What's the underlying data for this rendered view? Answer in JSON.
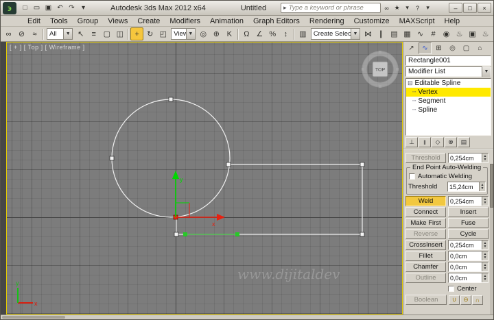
{
  "window": {
    "app_title": "Autodesk 3ds Max  2012 x64",
    "doc_title": "Untitled",
    "search_go_glyph": "▸",
    "search_placeholder": "Type a keyword or phrase",
    "quick_access": [
      {
        "name": "new-scene-button",
        "glyph": "□"
      },
      {
        "name": "open-file-button",
        "glyph": "▭"
      },
      {
        "name": "save-file-button",
        "glyph": "▣"
      },
      {
        "name": "undo-button",
        "glyph": "↶"
      },
      {
        "name": "redo-button",
        "glyph": "↷"
      },
      {
        "name": "workspace-dropdown-button",
        "glyph": "▾"
      }
    ],
    "search_icons": [
      {
        "name": "search-binoculars-icon",
        "glyph": "∞"
      },
      {
        "name": "favorites-star-icon",
        "glyph": "★"
      },
      {
        "name": "search-options-chevron-icon",
        "glyph": "▾"
      },
      {
        "name": "help-icon",
        "glyph": "?"
      },
      {
        "name": "help-chevron-icon",
        "glyph": "▾"
      }
    ],
    "controls": [
      {
        "name": "minimize-button",
        "glyph": "–"
      },
      {
        "name": "maximize-button",
        "glyph": "□"
      },
      {
        "name": "close-button",
        "glyph": "×"
      }
    ]
  },
  "menu": {
    "items": [
      "Edit",
      "Tools",
      "Group",
      "Views",
      "Create",
      "Modifiers",
      "Animation",
      "Graph Editors",
      "Rendering",
      "Customize",
      "MAXScript",
      "Help"
    ]
  },
  "toolbar": {
    "link_icons": [
      {
        "name": "select-and-link-icon",
        "glyph": "∞"
      },
      {
        "name": "unlink-selection-icon",
        "glyph": "⊘"
      },
      {
        "name": "bind-to-space-warp-icon",
        "glyph": "≈"
      }
    ],
    "filter_label": "All",
    "select_icons": [
      {
        "name": "select-object-icon",
        "glyph": "↖"
      },
      {
        "name": "select-by-name-icon",
        "glyph": "≡"
      },
      {
        "name": "rectangular-selection-region-icon",
        "glyph": "▢"
      },
      {
        "name": "window-crossing-icon",
        "glyph": "◫"
      }
    ],
    "transform_icons": [
      {
        "name": "select-and-move-icon",
        "glyph": "+",
        "active": true
      },
      {
        "name": "select-and-rotate-icon",
        "glyph": "↻"
      },
      {
        "name": "select-and-scale-icon",
        "glyph": "◰"
      }
    ],
    "coord_label": "View",
    "pivot_icons": [
      {
        "name": "use-pivot-point-center-icon",
        "glyph": "◎"
      },
      {
        "name": "select-and-manipulate-icon",
        "glyph": "⊕"
      },
      {
        "name": "keyboard-shortcut-override-icon",
        "glyph": "K"
      }
    ],
    "snap_icons": [
      {
        "name": "snaps-toggle-3d-icon",
        "glyph": "Ω"
      },
      {
        "name": "angle-snap-icon",
        "glyph": "∠"
      },
      {
        "name": "percent-snap-icon",
        "glyph": "%"
      },
      {
        "name": "spinner-snap-icon",
        "glyph": "↕"
      }
    ],
    "set_icons": [
      {
        "name": "named-selection-sets-icon",
        "glyph": "▥"
      }
    ],
    "selection_set_label": "Create Selection Se",
    "right_icons": [
      {
        "name": "mirror-icon",
        "glyph": "⋈"
      },
      {
        "name": "align-icon",
        "glyph": "∥"
      },
      {
        "name": "layer-manager-icon",
        "glyph": "▤"
      },
      {
        "name": "graphite-ribbon-icon",
        "glyph": "▦"
      },
      {
        "name": "curve-editor-icon",
        "glyph": "∿"
      },
      {
        "name": "schematic-view-icon",
        "glyph": "#"
      },
      {
        "name": "material-editor-icon",
        "glyph": "◉"
      },
      {
        "name": "render-setup-icon",
        "glyph": "♨"
      },
      {
        "name": "rendered-frame-window-icon",
        "glyph": "▣"
      },
      {
        "name": "render-production-icon",
        "glyph": "♨"
      }
    ]
  },
  "viewport": {
    "label": "[ + ] [ Top ] [ Wireframe ]",
    "viewcube_label": "TOP",
    "watermark": "www.dijitaldev",
    "axis_x": "x",
    "axis_y": "y"
  },
  "command_panel": {
    "tabs": [
      {
        "name": "tab-create",
        "glyph": "↗"
      },
      {
        "name": "tab-modify",
        "glyph": "∿",
        "active": true,
        "blue": true
      },
      {
        "name": "tab-hierarchy",
        "glyph": "⊞"
      },
      {
        "name": "tab-motion",
        "glyph": "◎"
      },
      {
        "name": "tab-display",
        "glyph": "▢"
      },
      {
        "name": "tab-utilities",
        "glyph": "⌂"
      }
    ],
    "object_name": "Rectangle001",
    "modifier_list_label": "Modifier List",
    "stack": [
      {
        "label": "Editable Spline",
        "prefix": "⊟",
        "child": false,
        "selected": false
      },
      {
        "label": "Vertex",
        "prefix": "┄",
        "child": true,
        "selected": true
      },
      {
        "label": "Segment",
        "prefix": "┄",
        "child": true,
        "selected": false
      },
      {
        "label": "Spline",
        "prefix": "┄",
        "child": true,
        "selected": false
      }
    ],
    "stack_tools": [
      {
        "name": "pin-stack-icon",
        "glyph": "⊥"
      },
      {
        "name": "show-end-result-icon",
        "glyph": "‖"
      },
      {
        "name": "make-unique-icon",
        "glyph": "◇"
      },
      {
        "name": "remove-modifier-icon",
        "glyph": "⊗"
      },
      {
        "name": "configure-modifier-sets-icon",
        "glyph": "▤"
      }
    ],
    "rollout": {
      "threshold_top_label": "Threshold",
      "threshold_top_value": "0,254cm",
      "group_title": "End Point Auto-Welding",
      "auto_weld_label": "Automatic Welding",
      "threshold_label": "Threshold",
      "threshold_value": "15,24cm",
      "rows": [
        {
          "left": "Weld",
          "left_type": "button-active",
          "right": "0,254cm",
          "right_type": "spinner"
        },
        {
          "left": "Connect",
          "left_type": "button",
          "right": "Insert",
          "right_type": "button"
        },
        {
          "left": "Make First",
          "left_type": "button",
          "right": "Fuse",
          "right_type": "button"
        },
        {
          "left": "Reverse",
          "left_type": "button-disabled",
          "right": "Cycle",
          "right_type": "button"
        },
        {
          "left": "CrossInsert",
          "left_type": "button",
          "right": "0,254cm",
          "right_type": "spinner"
        },
        {
          "left": "Fillet",
          "left_type": "button",
          "right": "0,0cm",
          "right_type": "spinner"
        },
        {
          "left": "Chamfer",
          "left_type": "button",
          "right": "0,0cm",
          "right_type": "spinner"
        },
        {
          "left": "Outline",
          "left_type": "button-disabled",
          "right": "0,0cm",
          "right_type": "spinner"
        }
      ],
      "center_label": "Center",
      "boolean_label": "Boolean",
      "boolean_icons": [
        {
          "name": "boolean-union-icon",
          "glyph": "∪"
        },
        {
          "name": "boolean-subtract-icon",
          "glyph": "⊖"
        },
        {
          "name": "boolean-intersect-icon",
          "glyph": "∩"
        }
      ]
    }
  }
}
